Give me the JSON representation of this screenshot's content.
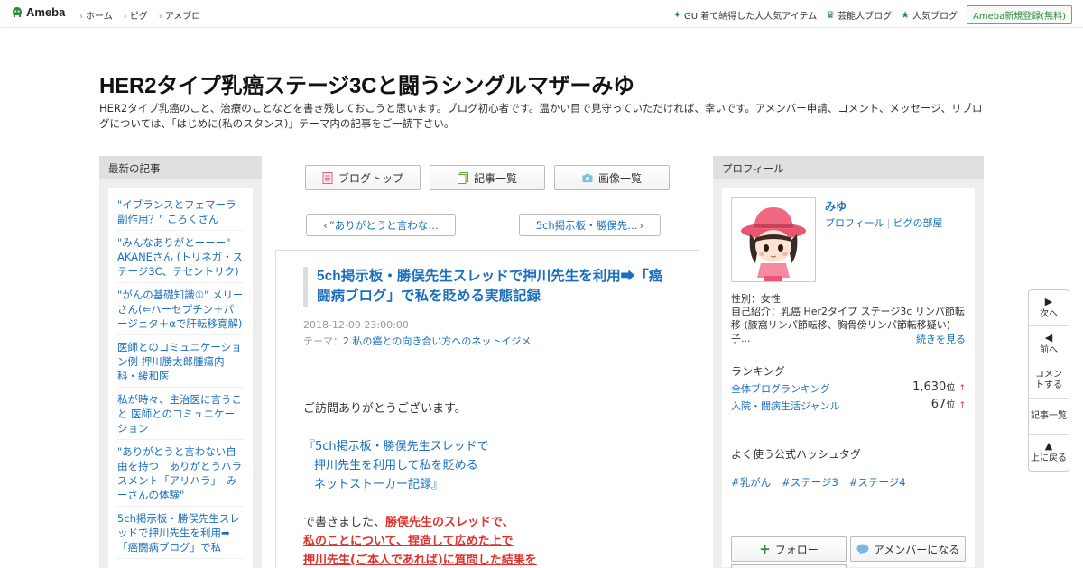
{
  "header": {
    "logo_text": "Ameba",
    "nav": [
      "ホーム",
      "ピグ",
      "アメブロ"
    ],
    "right_links": [
      {
        "label": "GU 着て納得した大人気アイテム",
        "icon": "sparkle-icon"
      },
      {
        "label": "芸能人ブログ",
        "icon": "crown-icon"
      },
      {
        "label": "人気ブログ",
        "icon": "star-icon"
      }
    ],
    "register_label": "Ameba新規登録(無料)"
  },
  "blog": {
    "title": "HER2タイプ乳癌ステージ3Cと闘うシングルマザーみゆ",
    "description": "HER2タイプ乳癌のこと、治療のことなどを書き残しておこうと思います。ブログ初心者です。温かい目で見守っていただければ、幸いです。アメンバー申請、コメント、メッセージ、リブログについては、「はじめに(私のスタンス)」テーマ内の記事をご一読下さい。"
  },
  "left_sidebar": {
    "heading": "最新の記事",
    "items": [
      "\"イブランスとフェマーラ副作用？\" ころくさん",
      "\"みんなありがとーーー\" AKANEさん (トリネガ・ステージ3C、テセントリク)",
      "\"がんの基礎知識①\" メリーさん(⇐ハーセプチン＋パージェタ＋αで肝転移寛解)",
      "医師とのコミュニケーション例 押川勝太郎腫瘍内科・緩和医",
      "私が時々、主治医に言うこと 医師とのコミュニケーション",
      "\"ありがとうと言わない自由を持つ　ありがとうハラスメント「アリハラ」　みーさんの体験\"",
      "5ch掲示板・勝俣先生スレッドで押川先生を利用➡「癌闘病ブログ」で私"
    ]
  },
  "center_nav": {
    "blog_top": "ブログトップ",
    "articles": "記事一覧",
    "images": "画像一覧",
    "prev_label": "”ありがとうと言わな…",
    "next_label": "5ch掲示板・勝俣先…"
  },
  "article": {
    "title": "5ch掲示板・勝俣先生スレッドで押川先生を利用➡「癌闘病ブログ」で私を貶める実態記録",
    "date": "2018-12-09 23:00:00",
    "theme_prefix": "テーマ：",
    "theme_link": "2 私の癌との向き合い方へのネットイジメ",
    "greeting": "ご訪問ありがとうございます。",
    "quote_line1": "『5ch掲示板・勝俣先生スレッドで",
    "quote_line2": "押川先生を利用して私を貶める",
    "quote_line3": "ネットストーカー記録』",
    "body_prefix": "で書きました、",
    "red_text1": "勝俣先生のスレッドで、",
    "red_text2": "私のことについて、捏造して広めた上で",
    "red_text3": "押川先生(ご本人であれば)に質問した結果を"
  },
  "profile": {
    "heading": "プロフィール",
    "name": "みゆ",
    "profile_link": "プロフィール",
    "pig_link": "ピグの部屋",
    "gender": "性別：女性",
    "intro": "自己紹介：乳癌 Her2タイプ ステージ3c リンパ節転移 (腋窩リンパ節転移、胸骨傍リンパ節転移疑い) 子...",
    "more": "続きを見る",
    "ranking_heading": "ランキング",
    "rankings": [
      {
        "label": "全体ブログランキング",
        "value": "1,630",
        "unit": "位",
        "arrow": "↑"
      },
      {
        "label": "入院・闘病生活ジャンル",
        "value": "67",
        "unit": "位",
        "arrow": "↑"
      }
    ],
    "hashtag_heading": "よく使う公式ハッシュタグ",
    "hashtags": [
      "#乳がん",
      "#ステージ3",
      "#ステージ4"
    ],
    "follow_label": "フォロー",
    "amember_label": "アメンバーになる"
  },
  "float_nav": {
    "next": "次へ",
    "prev": "前へ",
    "comment": "コメントする",
    "list": "記事一覧",
    "top": "上に戻る"
  },
  "colors": {
    "link": "#1a6fbf",
    "accent_green": "#2d8c3c",
    "alert_red": "#e0312c"
  }
}
